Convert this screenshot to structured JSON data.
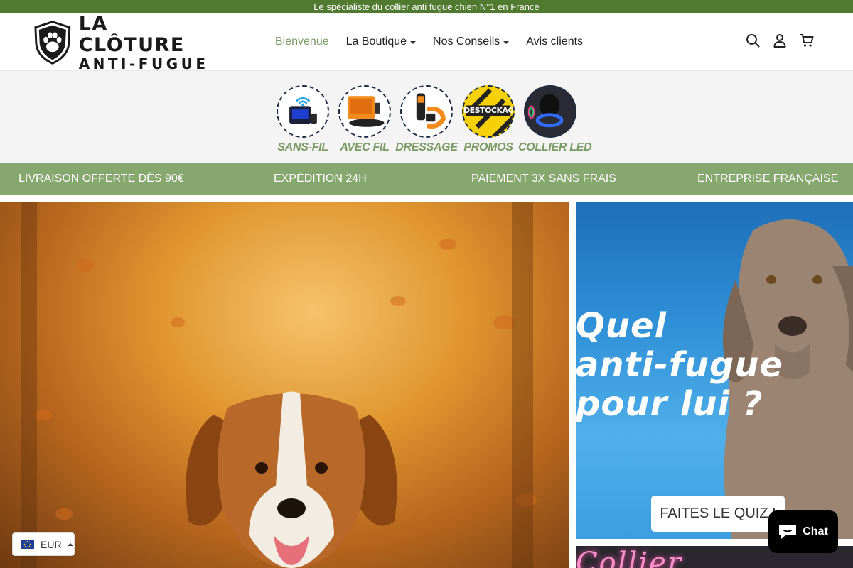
{
  "announcement": "Le spécialiste du collier anti fugue chien N°1 en France",
  "logo": {
    "line1": "LA CLÔTURE",
    "line2": "ANTI-FUGUE"
  },
  "nav": {
    "items": [
      {
        "label": "Bienvenue",
        "active": true,
        "dropdown": false
      },
      {
        "label": "La Boutique",
        "active": false,
        "dropdown": true
      },
      {
        "label": "Nos Conseils",
        "active": false,
        "dropdown": true
      },
      {
        "label": "Avis clients",
        "active": false,
        "dropdown": false
      }
    ]
  },
  "header_icons": [
    "search-icon",
    "account-icon",
    "cart-icon"
  ],
  "categories": [
    {
      "label": "SANS-FIL"
    },
    {
      "label": "AVEC FIL"
    },
    {
      "label": "DRESSAGE"
    },
    {
      "label": "PROMOS",
      "badge": "DESTOCKAGE"
    },
    {
      "label": "COLLIER LED"
    }
  ],
  "benefits": [
    "LIVRAISON OFFERTE DÈS 90€",
    "EXPÉDITION 24H",
    "PAIEMENT 3X SANS FRAIS",
    "ENTREPRISE FRANÇAISE"
  ],
  "quiz": {
    "line1": "Quel",
    "line2": "anti-fugue",
    "line3": "pour lui ?",
    "button": "FAITES LE QUIZ !"
  },
  "led_banner": "Collier",
  "currency": "EUR",
  "chat": "Chat",
  "colors": {
    "announcement_bg": "#4f7a2f",
    "accent": "#7a9a63",
    "benefits_bg": "#86a86f",
    "quiz_bg": "#2f8fd6"
  }
}
